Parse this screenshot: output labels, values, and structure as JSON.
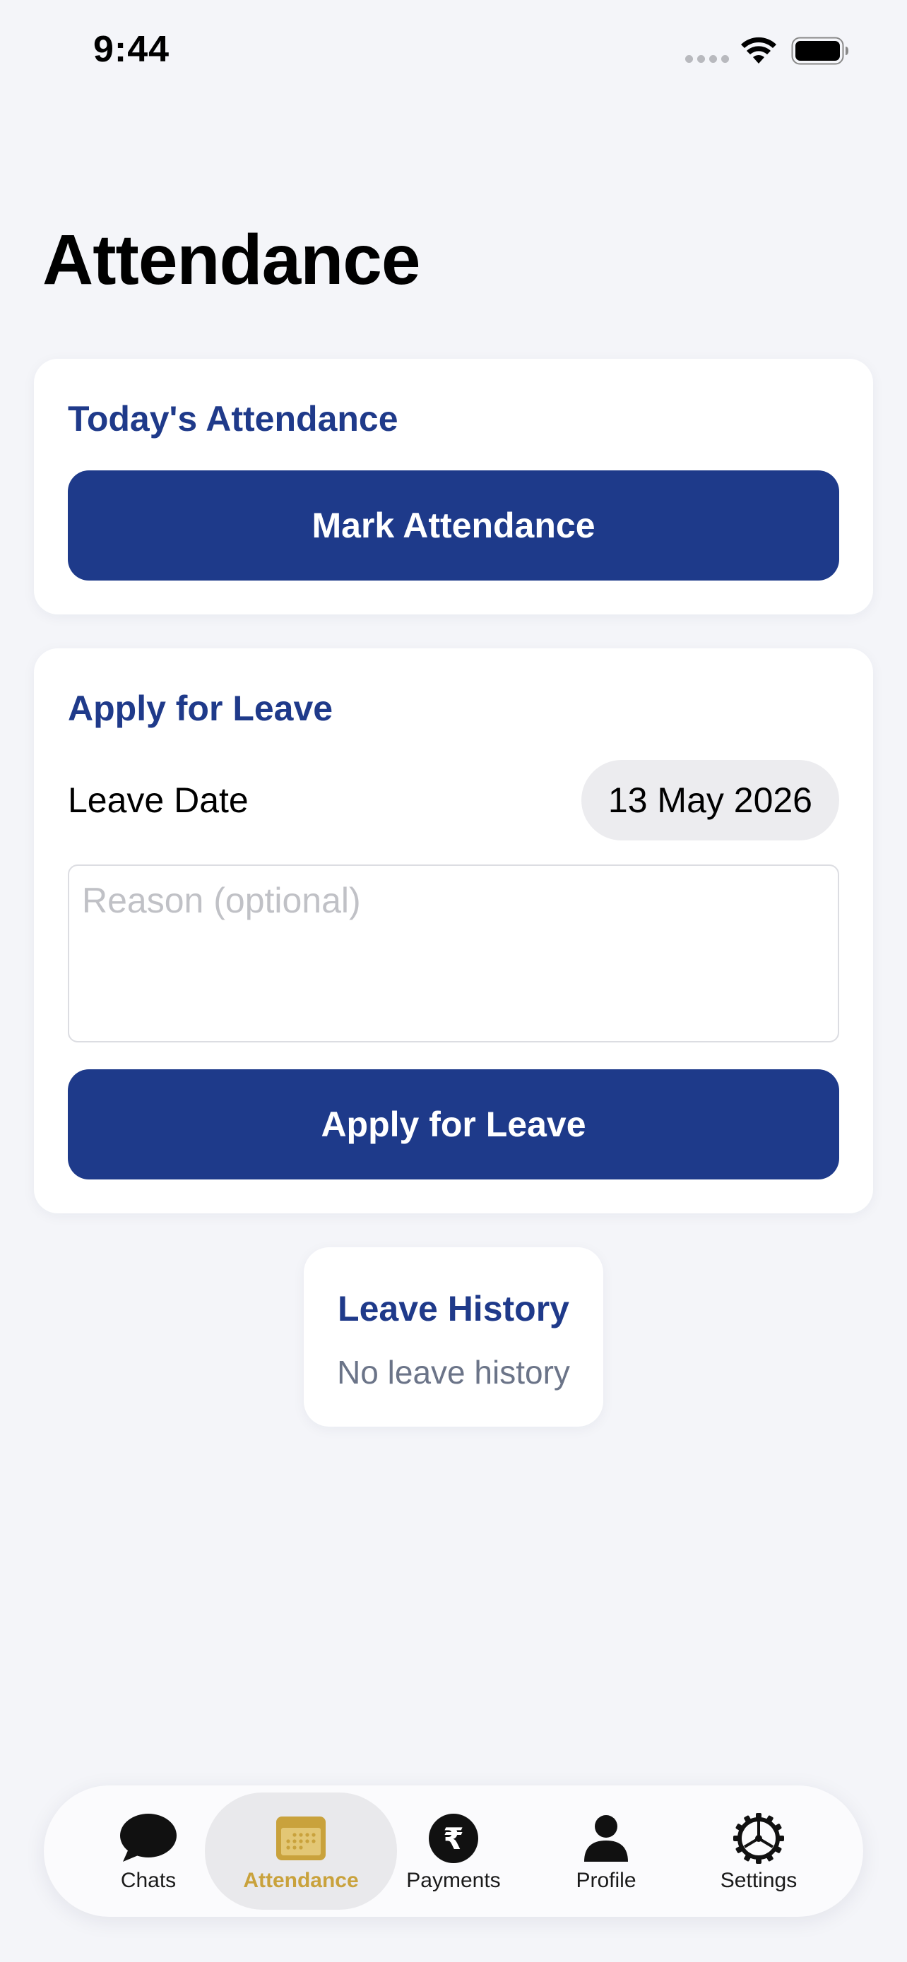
{
  "status_bar": {
    "time": "9:44"
  },
  "page": {
    "title": "Attendance"
  },
  "today_card": {
    "title": "Today's Attendance",
    "mark_button_label": "Mark Attendance"
  },
  "leave_card": {
    "title": "Apply for Leave",
    "date_label": "Leave Date",
    "date_value": "13 May 2026",
    "reason_placeholder": "Reason (optional)",
    "reason_value": "",
    "submit_label": "Apply for Leave"
  },
  "history_card": {
    "title": "Leave History",
    "empty_text": "No leave history"
  },
  "tab_bar": {
    "tabs": [
      {
        "label": "Chats",
        "icon": "chat-bubble-icon"
      },
      {
        "label": "Attendance",
        "icon": "calendar-icon"
      },
      {
        "label": "Payments",
        "icon": "rupee-icon"
      },
      {
        "label": "Profile",
        "icon": "person-icon"
      },
      {
        "label": "Settings",
        "icon": "gear-icon"
      }
    ],
    "active_index": 1
  },
  "colors": {
    "primary": "#1e3a8a",
    "accent_active_tab": "#c9a23c",
    "background": "#f4f5f9",
    "muted_text": "#6b7488"
  }
}
